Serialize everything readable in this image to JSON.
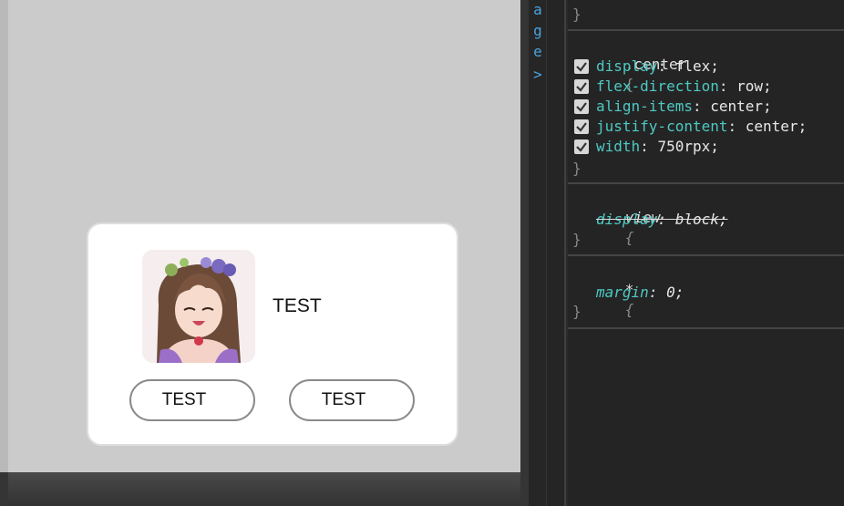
{
  "simulator": {
    "popup": {
      "title": "TEST",
      "buttons": [
        "TEST",
        "TEST"
      ]
    }
  },
  "devtools": {
    "gutter_letters": [
      "a",
      "g",
      "e",
      ">"
    ],
    "top_close_brace": "}",
    "rules": [
      {
        "selector": ".center",
        "open": "{",
        "close": "}",
        "declarations": [
          {
            "prop": "display",
            "value": "flex;",
            "checked": true
          },
          {
            "prop": "flex-direction",
            "value": "row;",
            "checked": true
          },
          {
            "prop": "align-items",
            "value": "center;",
            "checked": true
          },
          {
            "prop": "justify-content",
            "value": "center;",
            "checked": true
          },
          {
            "prop": "width",
            "value": "750rpx;",
            "checked": true
          }
        ]
      },
      {
        "selector": "view",
        "open": "{",
        "close": "}",
        "declarations": [
          {
            "prop": "display",
            "value": "block;",
            "overridden": true
          }
        ]
      },
      {
        "selector": "*",
        "open": "{",
        "close": "}",
        "declarations": [
          {
            "prop": "margin",
            "value": "0;"
          }
        ]
      }
    ]
  },
  "colors": {
    "property": "#4ec9c3",
    "gutter_accent": "#4aa3df",
    "simulator_bg": "#cbcbcb"
  }
}
